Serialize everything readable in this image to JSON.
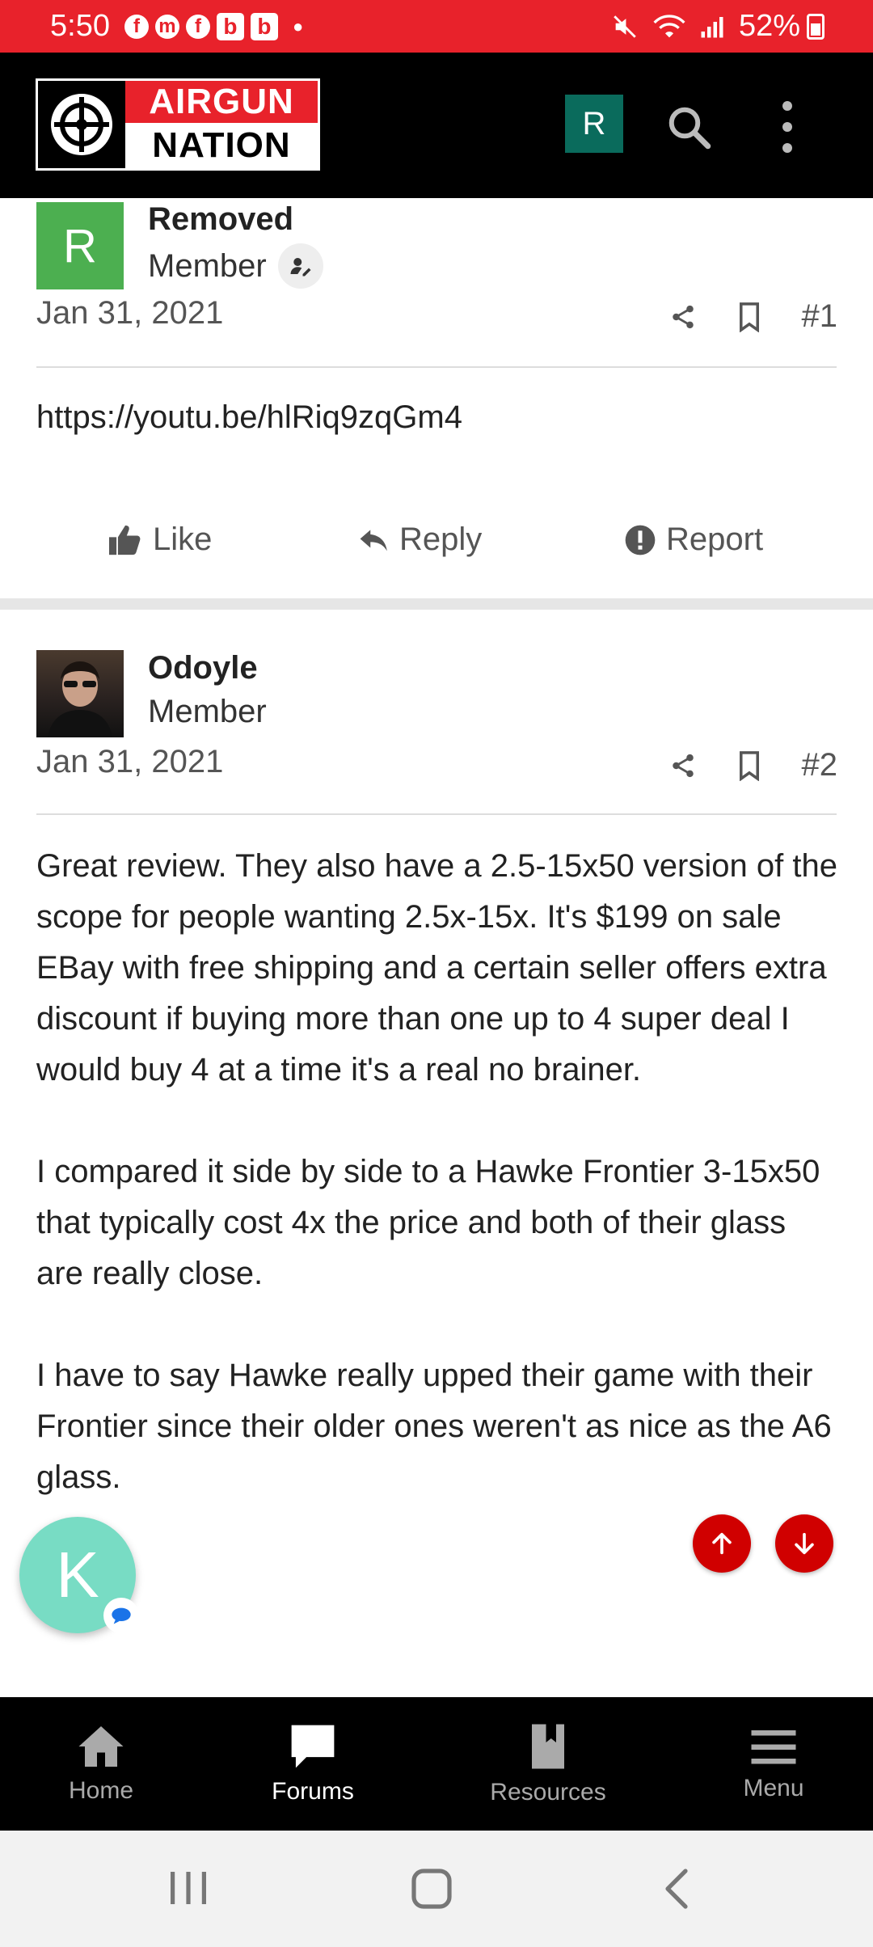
{
  "status_bar": {
    "time": "5:50",
    "notif_letter_1": "b",
    "notif_letter_2": "b",
    "battery": "52%"
  },
  "header": {
    "logo_line1": "AIRGUN",
    "logo_line2": "NATION",
    "user_initial": "R"
  },
  "posts": [
    {
      "username": "Removed",
      "role": "Member",
      "avatar_initial": "R",
      "avatar_color": "#4caf50",
      "date": "Jan 31, 2021",
      "number": "#1",
      "body": [
        "https://youtu.be/hlRiq9zqGm4"
      ],
      "actions": {
        "like": "Like",
        "reply": "Reply",
        "report": "Report"
      }
    },
    {
      "username": "Odoyle",
      "role": "Member",
      "date": "Jan 31, 2021",
      "number": "#2",
      "body": [
        "Great review. They also have a 2.5-15x50 version of the scope for people wanting 2.5x-15x. It's $199 on sale EBay with free shipping and a certain seller offers extra discount if buying more than one up to 4 super deal I would buy 4 at a time it's a real no brainer.",
        "I compared it side by side to a Hawke Frontier 3-15x50 that typically cost 4x the price and both of their glass are really close.",
        "I have to say Hawke really upped their game with their Frontier since their older ones weren't as nice as the A6 glass."
      ]
    }
  ],
  "chat_head": {
    "initial": "K"
  },
  "bottom_nav": [
    {
      "label": "Home",
      "icon": "home-icon"
    },
    {
      "label": "Forums",
      "icon": "forums-icon",
      "active": true
    },
    {
      "label": "Resources",
      "icon": "resources-icon"
    },
    {
      "label": "Menu",
      "icon": "menu-icon"
    }
  ],
  "colors": {
    "status_bar": "#e8222b",
    "header": "#000000",
    "accent_red": "#d00000",
    "header_avatar": "#0a6b5c"
  }
}
